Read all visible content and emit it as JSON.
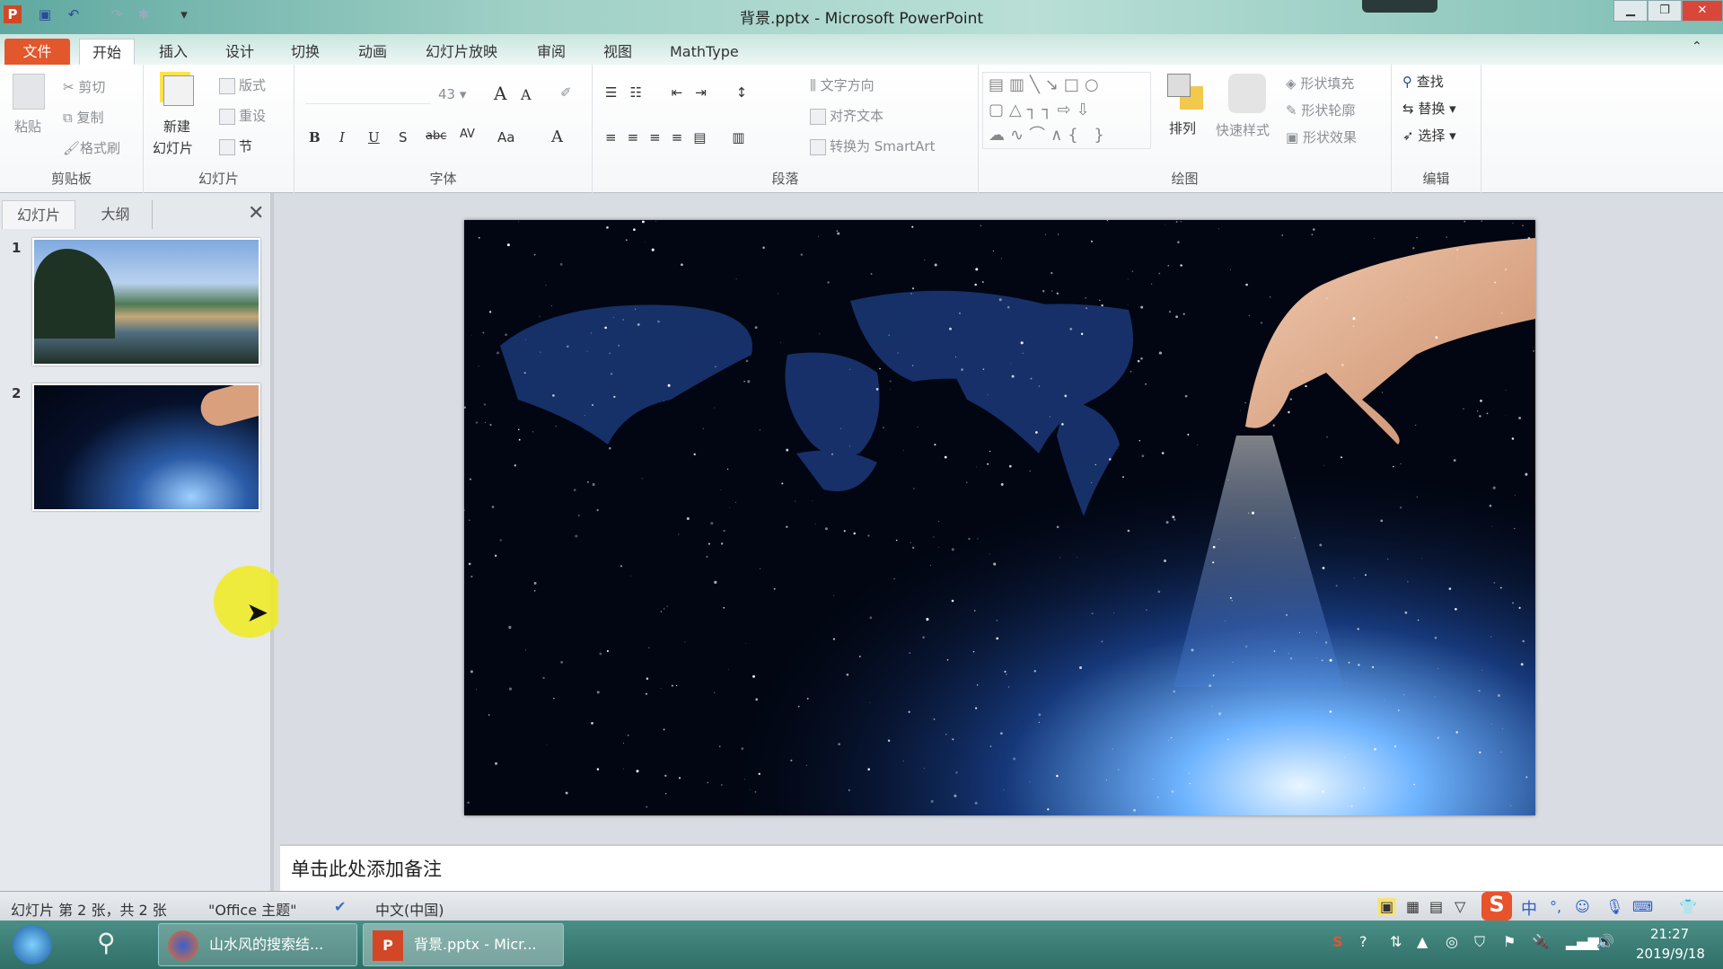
{
  "window": {
    "title": "背景.pptx - Microsoft PowerPoint",
    "app_icon": "P",
    "buttons": [
      "minimize",
      "restore",
      "close"
    ]
  },
  "quick_access": {
    "icons": [
      "save-icon",
      "undo-icon",
      "redo-icon",
      "repeat-icon",
      "customize-icon"
    ]
  },
  "tabs": [
    {
      "label": "文件"
    },
    {
      "label": "开始",
      "active": true
    },
    {
      "label": "插入"
    },
    {
      "label": "设计"
    },
    {
      "label": "切换"
    },
    {
      "label": "动画"
    },
    {
      "label": "幻灯片放映"
    },
    {
      "label": "审阅"
    },
    {
      "label": "视图"
    },
    {
      "label": "MathType"
    }
  ],
  "ribbon": {
    "clipboard": {
      "label": "剪贴板",
      "paste": "粘贴",
      "cut": "剪切",
      "copy": "复制",
      "format_painter": "格式刷"
    },
    "slides": {
      "label": "幻灯片",
      "new_slide_1": "新建",
      "new_slide_2": "幻灯片",
      "layout": "版式",
      "reset": "重设",
      "section": "节"
    },
    "font": {
      "label": "字体",
      "size": "43",
      "bold": "B",
      "italic": "I",
      "underline": "U",
      "shadow": "S",
      "strike": "abc",
      "spacing": "AV",
      "case": "Aa",
      "color": "A",
      "grow": "A",
      "shrink": "A"
    },
    "paragraph": {
      "label": "段落",
      "text_direction": "文字方向",
      "align_text": "对齐文本",
      "smartart": "转换为 SmartArt"
    },
    "drawing": {
      "label": "绘图",
      "arrange": "排列",
      "quick_styles": "快速样式",
      "fill": "形状填充",
      "outline": "形状轮廓",
      "effects": "形状效果"
    },
    "editing": {
      "label": "编辑",
      "find": "查找",
      "replace": "替换",
      "select": "选择"
    }
  },
  "left_panel": {
    "tabs": [
      "幻灯片",
      "大纲"
    ],
    "slides": [
      {
        "number": "1"
      },
      {
        "number": "2",
        "selected": true
      }
    ]
  },
  "notes": {
    "placeholder": "单击此处添加备注"
  },
  "status": {
    "slide_info": "幻灯片 第 2 张，共 2 张",
    "theme": "\"Office 主题\"",
    "language": "中文(中国)"
  },
  "ime": {
    "mode": "中",
    "punct": "°,"
  },
  "taskbar": {
    "items": [
      {
        "label": "山水风的搜索结..."
      },
      {
        "label": "背景.pptx - Micr..."
      }
    ],
    "time": "21:27",
    "date": "2019/9/18"
  },
  "colors": {
    "file_tab": "#e2572b",
    "slide_bg": "#020612",
    "taskbar": "#3a7d75"
  }
}
